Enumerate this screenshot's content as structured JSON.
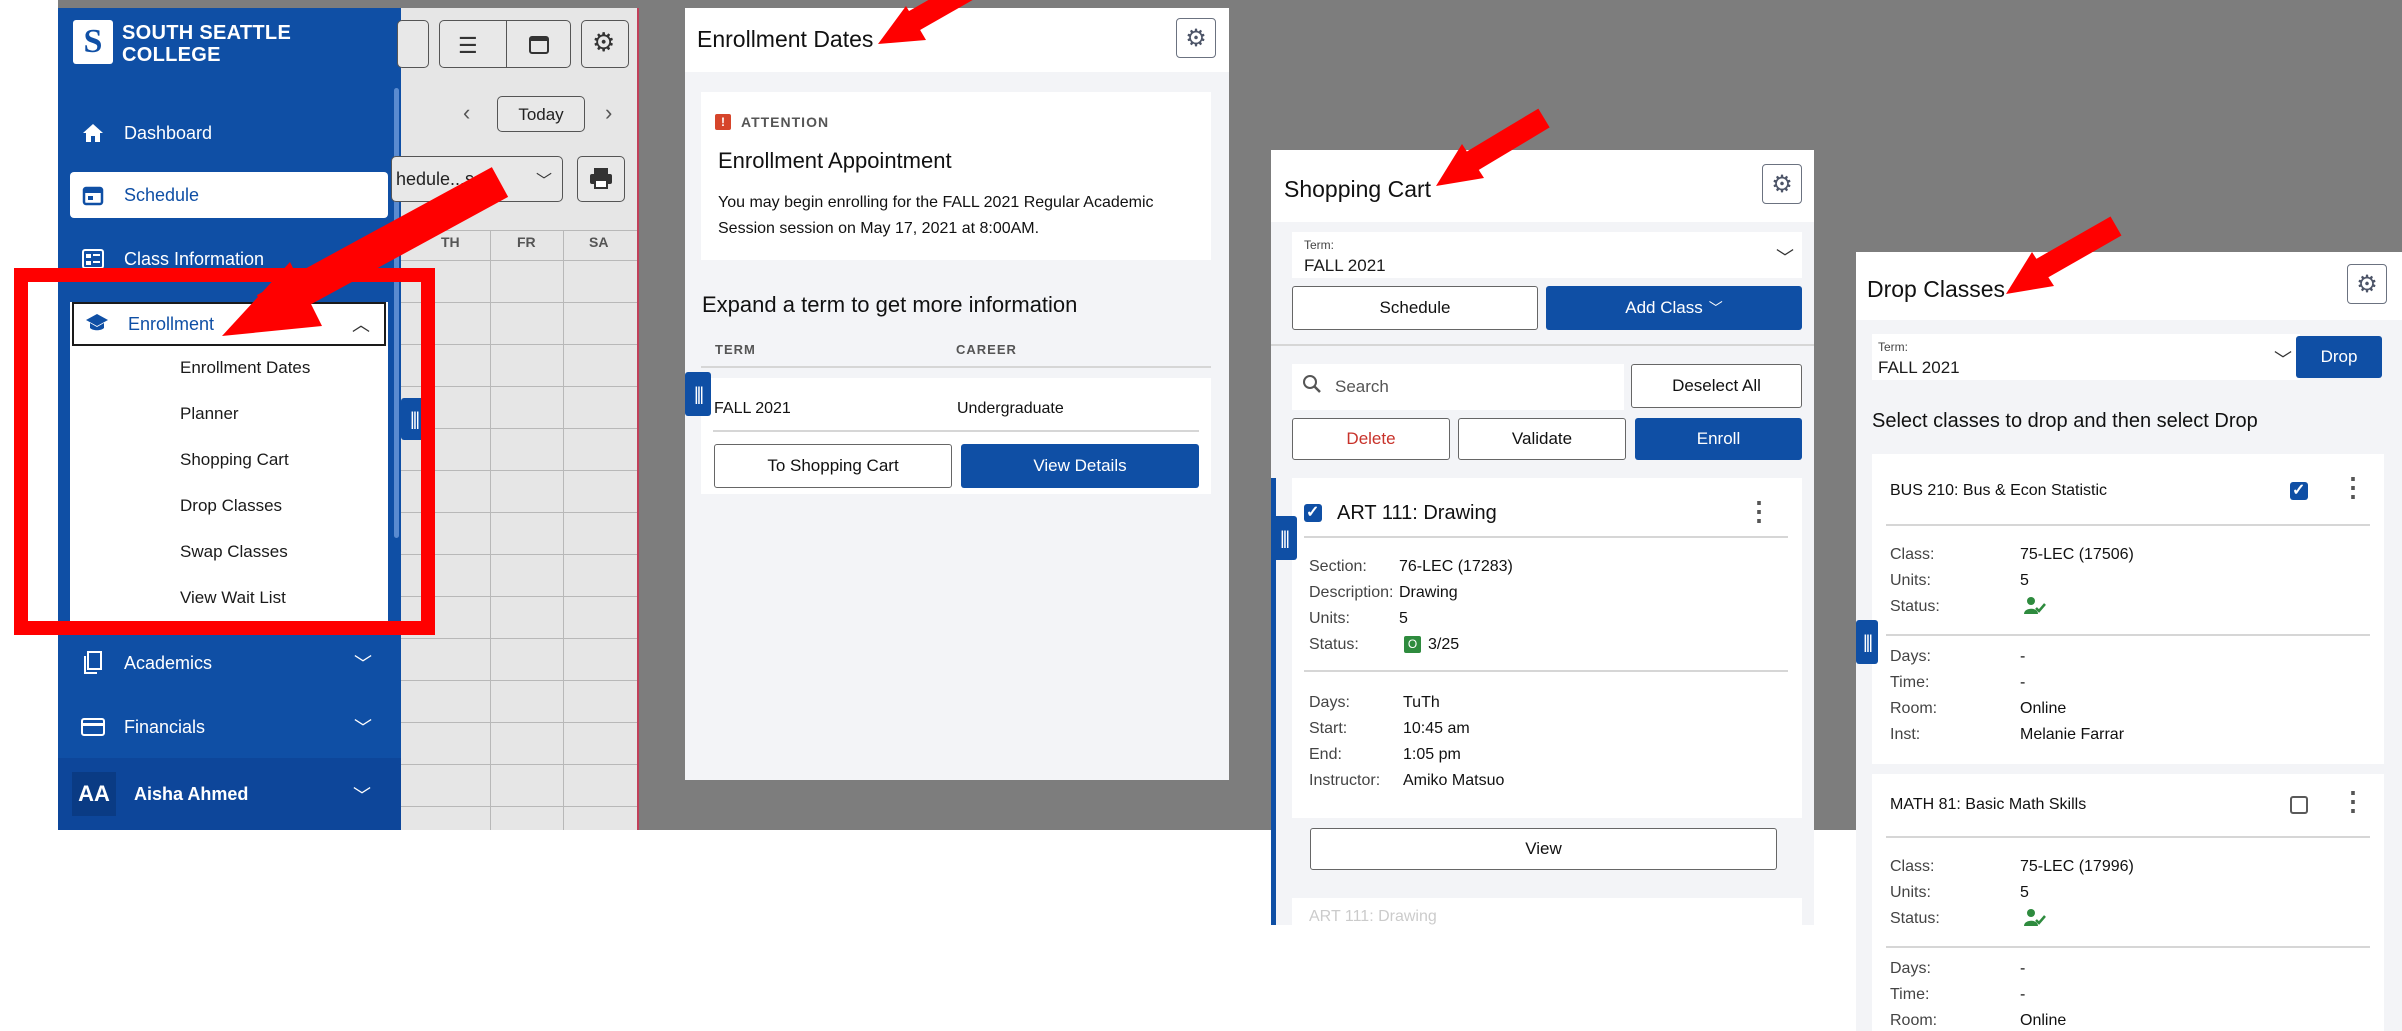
{
  "sidebar": {
    "college_line1": "SOUTH SEATTLE",
    "college_line2": "COLLEGE",
    "items": [
      {
        "label": "Dashboard",
        "icon": "home-icon"
      },
      {
        "label": "Schedule",
        "icon": "calendar-icon"
      },
      {
        "label": "Class Information",
        "icon": "class-info-icon"
      },
      {
        "label": "Enrollment",
        "icon": "graduation-cap-icon"
      },
      {
        "label": "Academics",
        "icon": "document-icon"
      },
      {
        "label": "Financials",
        "icon": "credit-card-icon"
      }
    ],
    "enrollment_subitems": [
      "Enrollment Dates",
      "Planner",
      "Shopping Cart",
      "Drop Classes",
      "Swap Classes",
      "View Wait List"
    ],
    "user": {
      "initials": "AA",
      "name": "Aisha Ahmed"
    }
  },
  "calendar": {
    "today_label": "Today",
    "schedule_select_fragment": "hedule...s...",
    "day_headers": [
      "TH",
      "FR",
      "SA"
    ]
  },
  "enrollment_dates": {
    "title": "Enrollment Dates",
    "attention_label": "ATTENTION",
    "appointment_title": "Enrollment Appointment",
    "appointment_text": "You may begin enrolling for the FALL 2021 Regular Academic Session session on May 17, 2021 at 8:00AM.",
    "expand_heading": "Expand a term to get more information",
    "col_term": "TERM",
    "col_career": "CAREER",
    "row_term": "FALL 2021",
    "row_career": "Undergraduate",
    "btn_cart": "To Shopping Cart",
    "btn_details": "View Details"
  },
  "shopping_cart": {
    "title": "Shopping Cart",
    "term_label": "Term:",
    "term_value": "FALL 2021",
    "btn_schedule": "Schedule",
    "btn_add_class": "Add Class",
    "search_placeholder": "Search",
    "btn_deselect": "Deselect All",
    "btn_delete": "Delete",
    "btn_validate": "Validate",
    "btn_enroll": "Enroll",
    "course_title": "ART 111: Drawing",
    "labels": {
      "section": "Section:",
      "description": "Description:",
      "units": "Units:",
      "status": "Status:",
      "days": "Days:",
      "start": "Start:",
      "end": "End:",
      "instructor": "Instructor:"
    },
    "section": "76-LEC (17283)",
    "description": "Drawing",
    "units": "5",
    "status_badge": "O",
    "status_count": "3/25",
    "days": "TuTh",
    "start": "10:45 am",
    "end": "1:05 pm",
    "instructor": "Amiko Matsuo",
    "btn_view": "View",
    "next_course_fragment": "ART 111: Drawing"
  },
  "drop_classes": {
    "title": "Drop Classes",
    "term_label": "Term:",
    "term_value": "FALL 2021",
    "btn_drop": "Drop",
    "instruction": "Select classes to drop and then select Drop",
    "labels": {
      "class": "Class:",
      "units": "Units:",
      "status": "Status:",
      "days": "Days:",
      "time": "Time:",
      "room": "Room:",
      "inst": "Inst:"
    },
    "courses": [
      {
        "title": "BUS 210: Bus & Econ Statistic",
        "class": "75-LEC (17506)",
        "units": "5",
        "days": "-",
        "time": "-",
        "room": "Online",
        "inst": "Melanie Farrar",
        "checked": true
      },
      {
        "title": "MATH 81: Basic Math Skills",
        "class": "75-LEC (17996)",
        "units": "5",
        "days": "-",
        "time": "-",
        "room": "Online",
        "checked": false
      }
    ]
  },
  "colors": {
    "brand": "#0f4fa5",
    "annotation": "#ff0000",
    "status_open": "#2e8b3e"
  }
}
